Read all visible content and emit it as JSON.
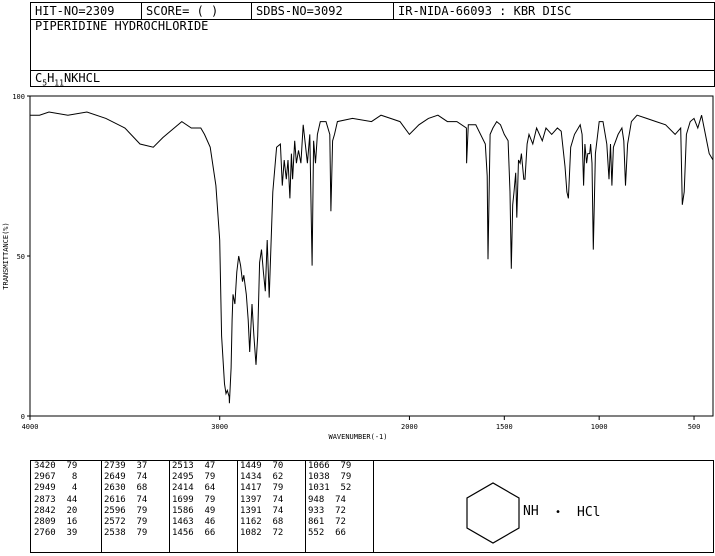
{
  "header": {
    "hit_no": "HIT-NO=2309",
    "score": "SCORE=  (   )",
    "sdbs_no": "SDBS-NO=3092",
    "ir_code": "IR-NIDA-66093 : KBR DISC"
  },
  "compound_name": "PIPERIDINE HYDROCHLORIDE",
  "formula": {
    "c": "C",
    "c_sub": "5",
    "h": "H",
    "h_sub": "11",
    "rest": "NKHCL"
  },
  "chart_data": {
    "type": "line",
    "xlabel": "WAVENUMBER(-1)",
    "ylabel": "TRANSMITTANCE(%)",
    "xlim": [
      4000,
      400
    ],
    "ylim": [
      0,
      100
    ],
    "x_ticks": [
      4000,
      3000,
      2000,
      1500,
      1000,
      500
    ],
    "y_ticks": [
      0,
      50,
      100
    ],
    "series": [
      {
        "x": [
          4000,
          3950,
          3900,
          3800,
          3700,
          3600,
          3500,
          3420,
          3350,
          3300,
          3200,
          3150,
          3100,
          3080,
          3050,
          3020,
          3000,
          2990,
          2975,
          2967,
          2960,
          2950,
          2949,
          2940,
          2935,
          2930,
          2920,
          2910,
          2900,
          2890,
          2880,
          2873,
          2860,
          2850,
          2842,
          2830,
          2820,
          2809,
          2800,
          2790,
          2780,
          2770,
          2760,
          2750,
          2739,
          2720,
          2700,
          2680,
          2670,
          2660,
          2649,
          2640,
          2630,
          2622,
          2616,
          2605,
          2596,
          2585,
          2572,
          2560,
          2538,
          2525,
          2513,
          2505,
          2495,
          2485,
          2470,
          2440,
          2420,
          2414,
          2405,
          2395,
          2380,
          2300,
          2200,
          2150,
          2100,
          2050,
          2000,
          1950,
          1900,
          1850,
          1800,
          1750,
          1700,
          1699,
          1690,
          1650,
          1600,
          1590,
          1586,
          1575,
          1560,
          1540,
          1520,
          1500,
          1480,
          1470,
          1463,
          1456,
          1449,
          1440,
          1434,
          1425,
          1417,
          1410,
          1397,
          1391,
          1380,
          1370,
          1350,
          1330,
          1300,
          1280,
          1250,
          1220,
          1200,
          1180,
          1170,
          1162,
          1150,
          1130,
          1100,
          1090,
          1082,
          1075,
          1066,
          1060,
          1050,
          1045,
          1038,
          1031,
          1020,
          1000,
          980,
          960,
          948,
          940,
          933,
          925,
          900,
          880,
          870,
          861,
          850,
          830,
          800,
          750,
          700,
          650,
          600,
          570,
          562,
          552,
          540,
          520,
          500,
          480,
          460,
          440,
          420,
          400
        ],
        "y": [
          94,
          94,
          95,
          94,
          95,
          93,
          90,
          85,
          84,
          87,
          92,
          90,
          90,
          88,
          84,
          72,
          55,
          25,
          10,
          7,
          8,
          6,
          4,
          15,
          30,
          38,
          35,
          45,
          50,
          47,
          42,
          44,
          38,
          30,
          20,
          35,
          25,
          16,
          25,
          48,
          52,
          45,
          39,
          55,
          37,
          70,
          84,
          85,
          72,
          80,
          74,
          80,
          68,
          82,
          74,
          86,
          79,
          83,
          79,
          91,
          79,
          88,
          47,
          86,
          79,
          88,
          92,
          92,
          88,
          64,
          86,
          88,
          92,
          93,
          92,
          94,
          93,
          92,
          88,
          91,
          93,
          94,
          92,
          92,
          90,
          79,
          91,
          91,
          85,
          75,
          49,
          88,
          90,
          92,
          91,
          88,
          86,
          70,
          46,
          66,
          70,
          76,
          62,
          80,
          79,
          82,
          74,
          74,
          85,
          88,
          85,
          90,
          86,
          90,
          88,
          90,
          89,
          78,
          70,
          68,
          84,
          88,
          91,
          88,
          72,
          85,
          79,
          82,
          82,
          85,
          79,
          52,
          82,
          92,
          92,
          85,
          74,
          85,
          72,
          84,
          88,
          90,
          86,
          72,
          85,
          92,
          94,
          93,
          92,
          91,
          88,
          90,
          66,
          70,
          88,
          92,
          93,
          90,
          94,
          88,
          82,
          80
        ]
      }
    ],
    "peaks": [
      [
        3420,
        79
      ],
      [
        2967,
        8
      ],
      [
        2949,
        4
      ],
      [
        2873,
        44
      ],
      [
        2842,
        20
      ],
      [
        2809,
        16
      ],
      [
        2760,
        39
      ],
      [
        2739,
        37
      ],
      [
        2649,
        74
      ],
      [
        2630,
        68
      ],
      [
        2616,
        74
      ],
      [
        2596,
        79
      ],
      [
        2572,
        79
      ],
      [
        2538,
        79
      ],
      [
        2513,
        47
      ],
      [
        2495,
        79
      ],
      [
        2414,
        64
      ],
      [
        1699,
        79
      ],
      [
        1586,
        49
      ],
      [
        1463,
        46
      ],
      [
        1456,
        66
      ],
      [
        1449,
        70
      ],
      [
        1434,
        62
      ],
      [
        1417,
        79
      ],
      [
        1397,
        74
      ],
      [
        1391,
        74
      ],
      [
        1162,
        68
      ],
      [
        1082,
        72
      ],
      [
        1066,
        79
      ],
      [
        1038,
        79
      ],
      [
        1031,
        52
      ],
      [
        948,
        74
      ],
      [
        933,
        72
      ],
      [
        861,
        72
      ],
      [
        552,
        66
      ]
    ]
  },
  "peak_table_rows": [
    "3420  79 | 2739  37 | 2513  47 | 1449  70 | 1066  79",
    "2967   8 | 2649  74 | 2495  79 | 1434  62 | 1038  79",
    "2949   4 | 2630  68 | 2414  64 | 1417  79 | 1031  52",
    "2873  44 | 2616  74 | 1699  79 | 1397  74 |  948  74",
    "2842  20 | 2596  79 | 1586  49 | 1391  74 |  933  72",
    "2809  16 | 2572  79 | 1463  46 | 1162  68 |  861  72",
    "2760  39 | 2538  79 | 1456  66 | 1082  72 |  552  66"
  ],
  "structure": {
    "nh_label": "NH",
    "dot": "•",
    "hcl_label": "HCl"
  }
}
